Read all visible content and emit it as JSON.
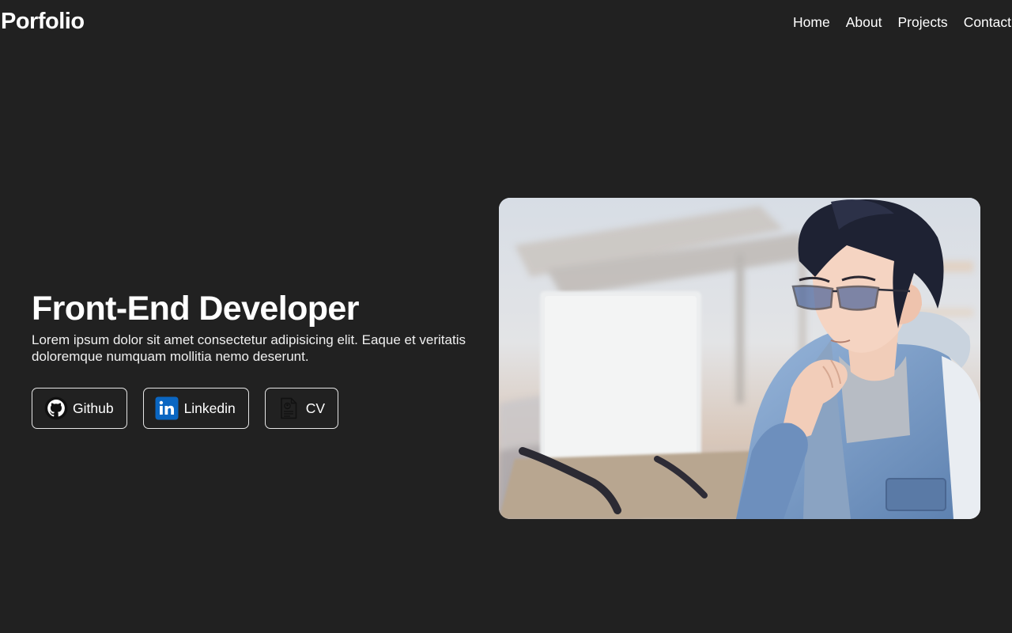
{
  "header": {
    "brand": "Porfolio",
    "nav": [
      "Home",
      "About",
      "Projects",
      "Contact"
    ]
  },
  "hero": {
    "title": "Front-End Developer",
    "description": "Lorem ipsum dolor sit amet consectetur adipisicing elit. Eaque et veritatis doloremque numquam mollitia nemo deserunt.",
    "buttons": [
      {
        "label": "Github",
        "icon": "github-icon"
      },
      {
        "label": "Linkedin",
        "icon": "linkedin-icon"
      },
      {
        "label": "CV",
        "icon": "document-icon"
      }
    ]
  },
  "image": {
    "subject": "illustration-developer-with-glasses"
  },
  "colors": {
    "background": "#212121",
    "text": "#ffffff",
    "linkedin": "#0a66c2"
  }
}
